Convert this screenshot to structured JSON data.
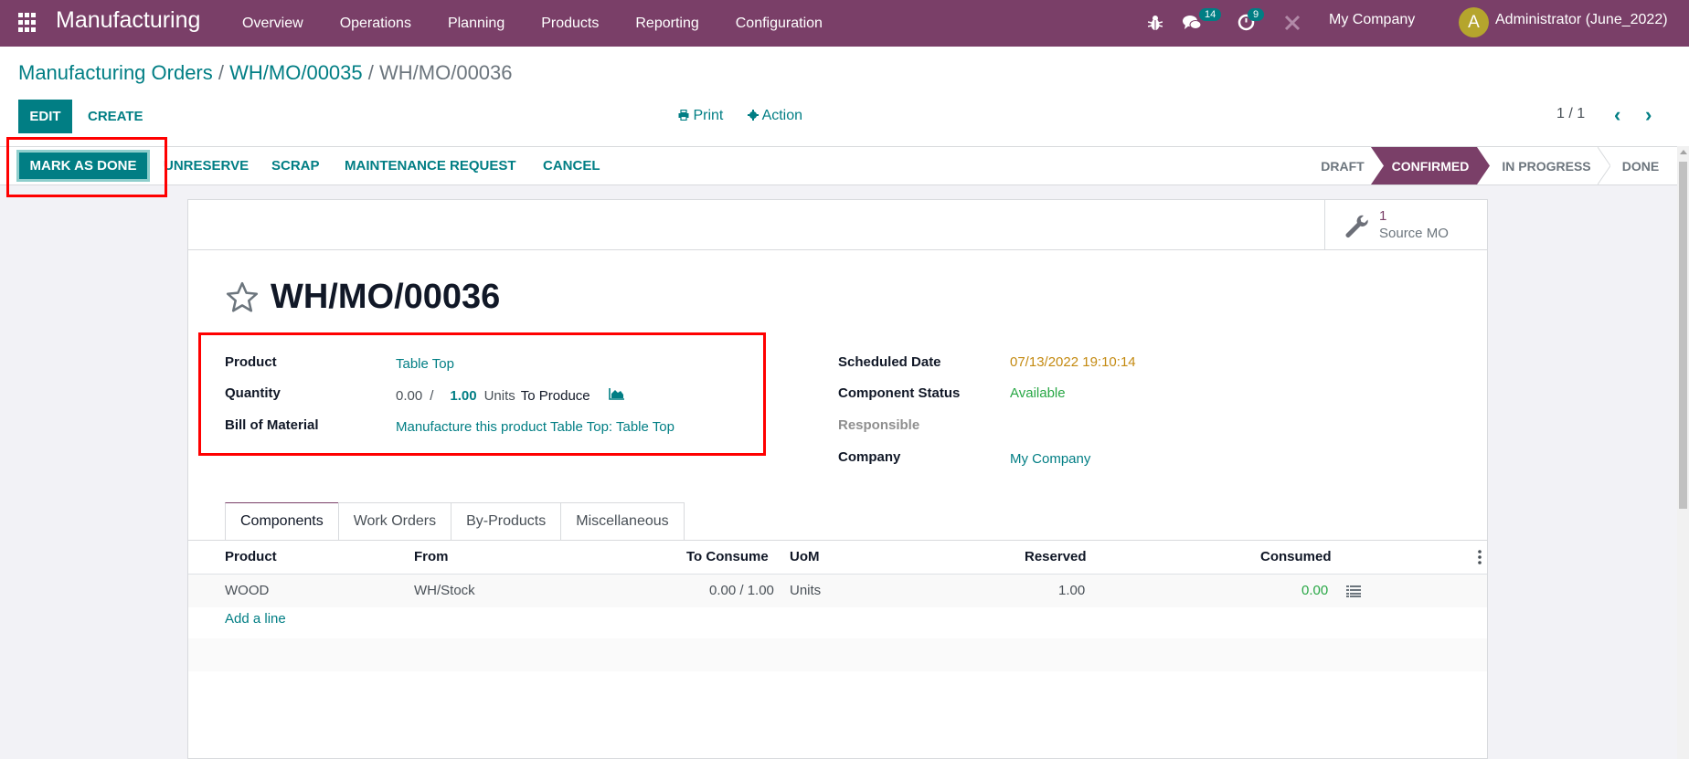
{
  "navbar": {
    "app_name": "Manufacturing",
    "menu": [
      "Overview",
      "Operations",
      "Planning",
      "Products",
      "Reporting",
      "Configuration"
    ],
    "messages_count": "14",
    "activities_count": "9",
    "company": "My Company",
    "avatar_initial": "A",
    "user": "Administrator (June_2022)"
  },
  "breadcrumb": {
    "items": [
      "Manufacturing Orders",
      "WH/MO/00035"
    ],
    "current": "WH/MO/00036",
    "separator": "/"
  },
  "toolbar": {
    "edit_label": "EDIT",
    "create_label": "CREATE",
    "print_label": "Print",
    "action_label": "Action",
    "pager": "1 / 1"
  },
  "statusbar": {
    "buttons": [
      "MARK AS DONE",
      "UNRESERVE",
      "SCRAP",
      "MAINTENANCE REQUEST",
      "CANCEL"
    ],
    "stages": [
      "DRAFT",
      "CONFIRMED",
      "IN PROGRESS",
      "DONE"
    ],
    "current_stage": "CONFIRMED"
  },
  "smart_button": {
    "count": "1",
    "label": "Source MO"
  },
  "record": {
    "title": "WH/MO/00036",
    "fields_left": {
      "product_label": "Product",
      "product_value": "Table Top",
      "quantity_label": "Quantity",
      "qty_produced": "0.00",
      "qty_sep": "/",
      "qty_to_produce": "1.00",
      "qty_uom": "Units",
      "qty_suffix": "To Produce",
      "bom_label": "Bill of Material",
      "bom_value": "Manufacture this product Table Top: Table Top"
    },
    "fields_right": {
      "scheduled_label": "Scheduled Date",
      "scheduled_value": "07/13/2022 19:10:14",
      "component_status_label": "Component Status",
      "component_status_value": "Available",
      "responsible_label": "Responsible",
      "company_label": "Company",
      "company_value": "My Company"
    }
  },
  "tabs": [
    "Components",
    "Work Orders",
    "By-Products",
    "Miscellaneous"
  ],
  "active_tab": "Components",
  "components_table": {
    "columns": [
      "Product",
      "From",
      "To Consume",
      "UoM",
      "Reserved",
      "Consumed"
    ],
    "rows": [
      {
        "product": "WOOD",
        "from": "WH/Stock",
        "to_consume": "0.00 / 1.00",
        "uom": "Units",
        "reserved": "1.00",
        "consumed": "0.00"
      }
    ],
    "add_line_label": "Add a line"
  },
  "colors": {
    "brand": "#7a3f68",
    "accent": "#017e84",
    "scheduled_date": "#c48a11",
    "available": "#28a745",
    "highlight": "#ff0000"
  }
}
